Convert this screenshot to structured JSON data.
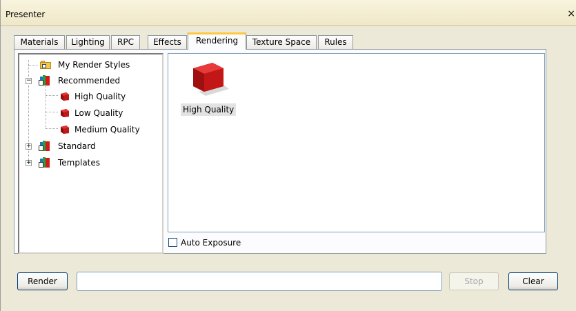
{
  "window": {
    "title": "Presenter",
    "close_glyph": "×"
  },
  "tabs": [
    {
      "label": "Materials"
    },
    {
      "label": "Lighting"
    },
    {
      "label": "RPC"
    },
    {
      "label": "Effects"
    },
    {
      "label": "Rendering"
    },
    {
      "label": "Texture Space"
    },
    {
      "label": "Rules"
    }
  ],
  "active_tab": "Rendering",
  "tree": {
    "items": [
      {
        "label": "My Render Styles",
        "icon": "folder-note-icon"
      },
      {
        "label": "Recommended",
        "icon": "library-books-icon",
        "expander": "−"
      },
      {
        "label": "High Quality",
        "icon": "render-style-cube-icon"
      },
      {
        "label": "Low Quality",
        "icon": "render-style-cube-icon"
      },
      {
        "label": "Medium Quality",
        "icon": "render-style-cube-icon"
      },
      {
        "label": "Standard",
        "icon": "library-books-icon",
        "expander": "+"
      },
      {
        "label": "Templates",
        "icon": "library-books-icon",
        "expander": "+"
      }
    ]
  },
  "preview": {
    "selected_item_label": "High Quality",
    "thumbnail_icon": "red-cube-icon"
  },
  "auto_exposure": {
    "label": "Auto Exposure",
    "checked": false
  },
  "footer": {
    "render_label": "Render",
    "status_value": "",
    "stop_label": "Stop",
    "clear_label": "Clear"
  },
  "colors": {
    "dialog_bg": "#ECE9D8",
    "active_tab_accent": "#FFC83C",
    "cube_red": "#D11A1A"
  }
}
